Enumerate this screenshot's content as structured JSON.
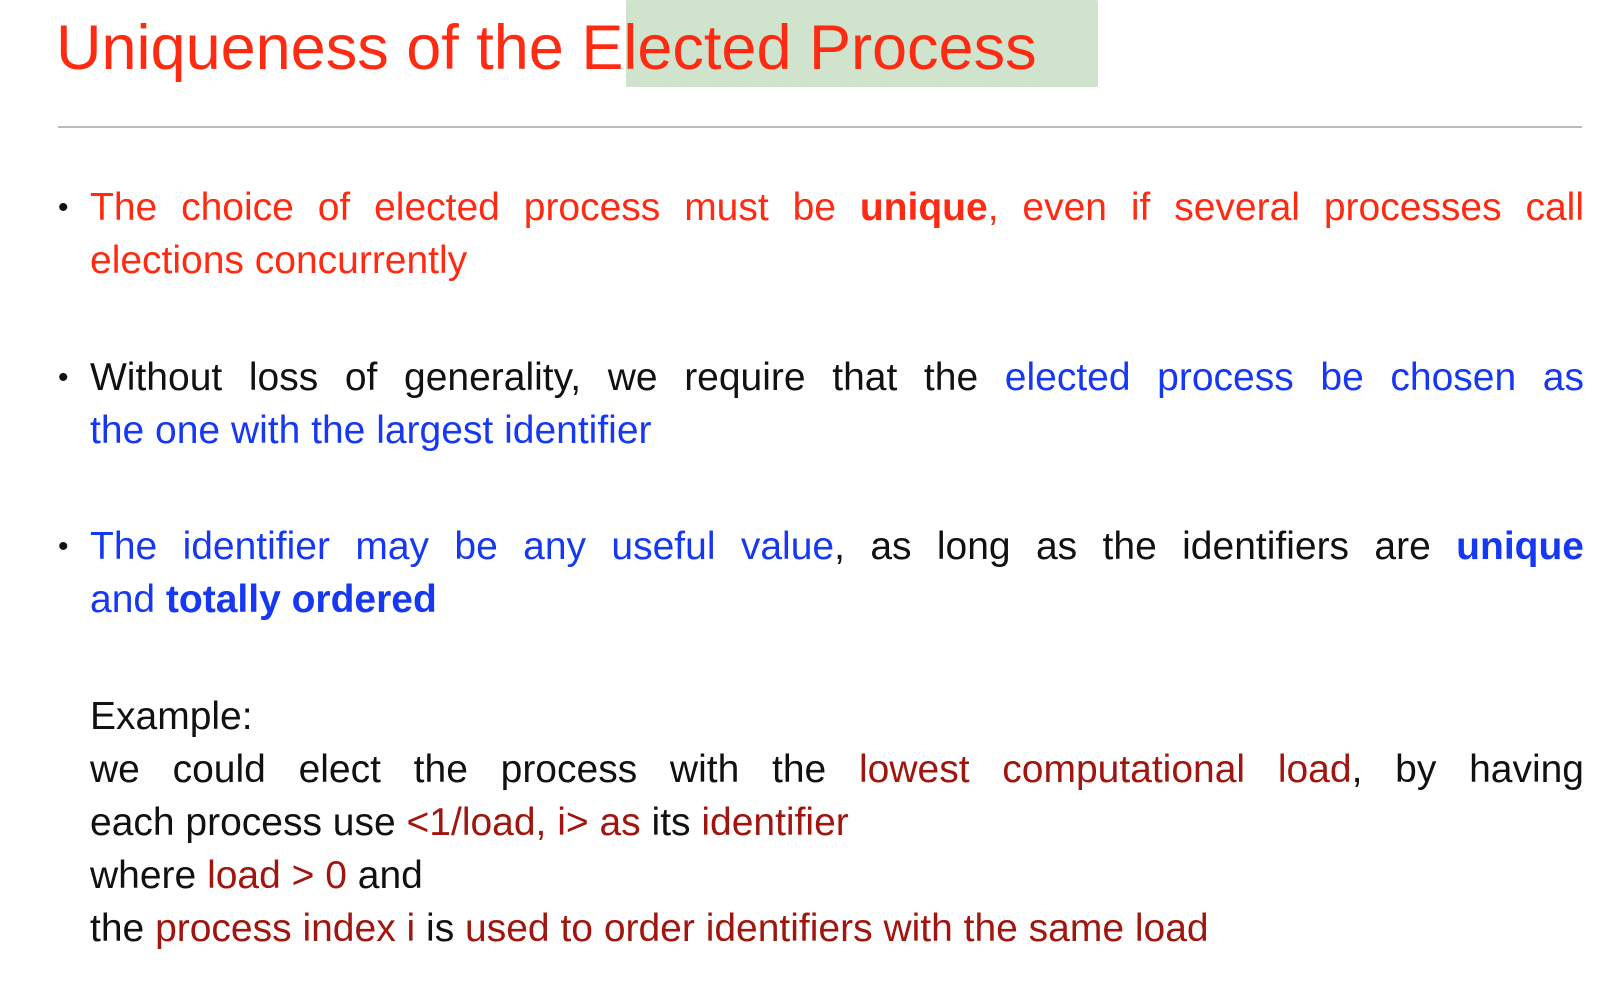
{
  "title": {
    "before": "Uniqueness of the ",
    "highlighted": "Elected Process"
  },
  "bullets": [
    {
      "line1_a": "The choice of elected process must be ",
      "line1_b": "unique",
      "line1_c": ", even if several processes call",
      "line2": "elections concurrently"
    },
    {
      "line1_a": "Without loss of generality, we require that the ",
      "line1_b": "elected process be chosen as",
      "line2": "the one with the largest identifier"
    },
    {
      "line1_a": "The identifier may be any useful value",
      "line1_b": ", as long as the identifiers are ",
      "line1_c": "unique",
      "line2_a": "and ",
      "line2_b": "totally ordered"
    }
  ],
  "example": {
    "heading": "Example:",
    "l1_a": "we could elect the process with the ",
    "l1_b": "lowest computational load",
    "l1_c": ", by having",
    "l2_a": "each process use ",
    "l2_b": "<1/load, i> as",
    "l2_c": " its ",
    "l2_d": "identifier",
    "l3_a": "where ",
    "l3_b": "load > 0",
    "l3_c": " and",
    "l4_a": "the ",
    "l4_b": "process index i",
    "l4_c": " is ",
    "l4_d": "used to order identifiers with the same load"
  },
  "colors": {
    "title": "#ff2a12",
    "highlight": "#cfe3cd",
    "red": "#ff2a12",
    "blue": "#1738f2",
    "maroon": "#a0150e",
    "text": "#111111"
  }
}
